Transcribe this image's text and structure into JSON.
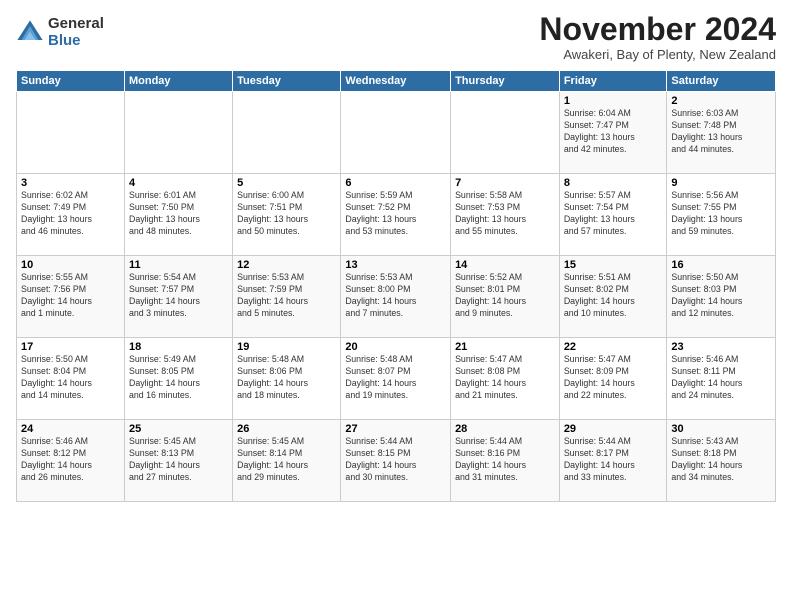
{
  "logo": {
    "general": "General",
    "blue": "Blue"
  },
  "header": {
    "month": "November 2024",
    "location": "Awakeri, Bay of Plenty, New Zealand"
  },
  "days_of_week": [
    "Sunday",
    "Monday",
    "Tuesday",
    "Wednesday",
    "Thursday",
    "Friday",
    "Saturday"
  ],
  "weeks": [
    [
      {
        "day": "",
        "info": ""
      },
      {
        "day": "",
        "info": ""
      },
      {
        "day": "",
        "info": ""
      },
      {
        "day": "",
        "info": ""
      },
      {
        "day": "",
        "info": ""
      },
      {
        "day": "1",
        "info": "Sunrise: 6:04 AM\nSunset: 7:47 PM\nDaylight: 13 hours\nand 42 minutes."
      },
      {
        "day": "2",
        "info": "Sunrise: 6:03 AM\nSunset: 7:48 PM\nDaylight: 13 hours\nand 44 minutes."
      }
    ],
    [
      {
        "day": "3",
        "info": "Sunrise: 6:02 AM\nSunset: 7:49 PM\nDaylight: 13 hours\nand 46 minutes."
      },
      {
        "day": "4",
        "info": "Sunrise: 6:01 AM\nSunset: 7:50 PM\nDaylight: 13 hours\nand 48 minutes."
      },
      {
        "day": "5",
        "info": "Sunrise: 6:00 AM\nSunset: 7:51 PM\nDaylight: 13 hours\nand 50 minutes."
      },
      {
        "day": "6",
        "info": "Sunrise: 5:59 AM\nSunset: 7:52 PM\nDaylight: 13 hours\nand 53 minutes."
      },
      {
        "day": "7",
        "info": "Sunrise: 5:58 AM\nSunset: 7:53 PM\nDaylight: 13 hours\nand 55 minutes."
      },
      {
        "day": "8",
        "info": "Sunrise: 5:57 AM\nSunset: 7:54 PM\nDaylight: 13 hours\nand 57 minutes."
      },
      {
        "day": "9",
        "info": "Sunrise: 5:56 AM\nSunset: 7:55 PM\nDaylight: 13 hours\nand 59 minutes."
      }
    ],
    [
      {
        "day": "10",
        "info": "Sunrise: 5:55 AM\nSunset: 7:56 PM\nDaylight: 14 hours\nand 1 minute."
      },
      {
        "day": "11",
        "info": "Sunrise: 5:54 AM\nSunset: 7:57 PM\nDaylight: 14 hours\nand 3 minutes."
      },
      {
        "day": "12",
        "info": "Sunrise: 5:53 AM\nSunset: 7:59 PM\nDaylight: 14 hours\nand 5 minutes."
      },
      {
        "day": "13",
        "info": "Sunrise: 5:53 AM\nSunset: 8:00 PM\nDaylight: 14 hours\nand 7 minutes."
      },
      {
        "day": "14",
        "info": "Sunrise: 5:52 AM\nSunset: 8:01 PM\nDaylight: 14 hours\nand 9 minutes."
      },
      {
        "day": "15",
        "info": "Sunrise: 5:51 AM\nSunset: 8:02 PM\nDaylight: 14 hours\nand 10 minutes."
      },
      {
        "day": "16",
        "info": "Sunrise: 5:50 AM\nSunset: 8:03 PM\nDaylight: 14 hours\nand 12 minutes."
      }
    ],
    [
      {
        "day": "17",
        "info": "Sunrise: 5:50 AM\nSunset: 8:04 PM\nDaylight: 14 hours\nand 14 minutes."
      },
      {
        "day": "18",
        "info": "Sunrise: 5:49 AM\nSunset: 8:05 PM\nDaylight: 14 hours\nand 16 minutes."
      },
      {
        "day": "19",
        "info": "Sunrise: 5:48 AM\nSunset: 8:06 PM\nDaylight: 14 hours\nand 18 minutes."
      },
      {
        "day": "20",
        "info": "Sunrise: 5:48 AM\nSunset: 8:07 PM\nDaylight: 14 hours\nand 19 minutes."
      },
      {
        "day": "21",
        "info": "Sunrise: 5:47 AM\nSunset: 8:08 PM\nDaylight: 14 hours\nand 21 minutes."
      },
      {
        "day": "22",
        "info": "Sunrise: 5:47 AM\nSunset: 8:09 PM\nDaylight: 14 hours\nand 22 minutes."
      },
      {
        "day": "23",
        "info": "Sunrise: 5:46 AM\nSunset: 8:11 PM\nDaylight: 14 hours\nand 24 minutes."
      }
    ],
    [
      {
        "day": "24",
        "info": "Sunrise: 5:46 AM\nSunset: 8:12 PM\nDaylight: 14 hours\nand 26 minutes."
      },
      {
        "day": "25",
        "info": "Sunrise: 5:45 AM\nSunset: 8:13 PM\nDaylight: 14 hours\nand 27 minutes."
      },
      {
        "day": "26",
        "info": "Sunrise: 5:45 AM\nSunset: 8:14 PM\nDaylight: 14 hours\nand 29 minutes."
      },
      {
        "day": "27",
        "info": "Sunrise: 5:44 AM\nSunset: 8:15 PM\nDaylight: 14 hours\nand 30 minutes."
      },
      {
        "day": "28",
        "info": "Sunrise: 5:44 AM\nSunset: 8:16 PM\nDaylight: 14 hours\nand 31 minutes."
      },
      {
        "day": "29",
        "info": "Sunrise: 5:44 AM\nSunset: 8:17 PM\nDaylight: 14 hours\nand 33 minutes."
      },
      {
        "day": "30",
        "info": "Sunrise: 5:43 AM\nSunset: 8:18 PM\nDaylight: 14 hours\nand 34 minutes."
      }
    ]
  ]
}
